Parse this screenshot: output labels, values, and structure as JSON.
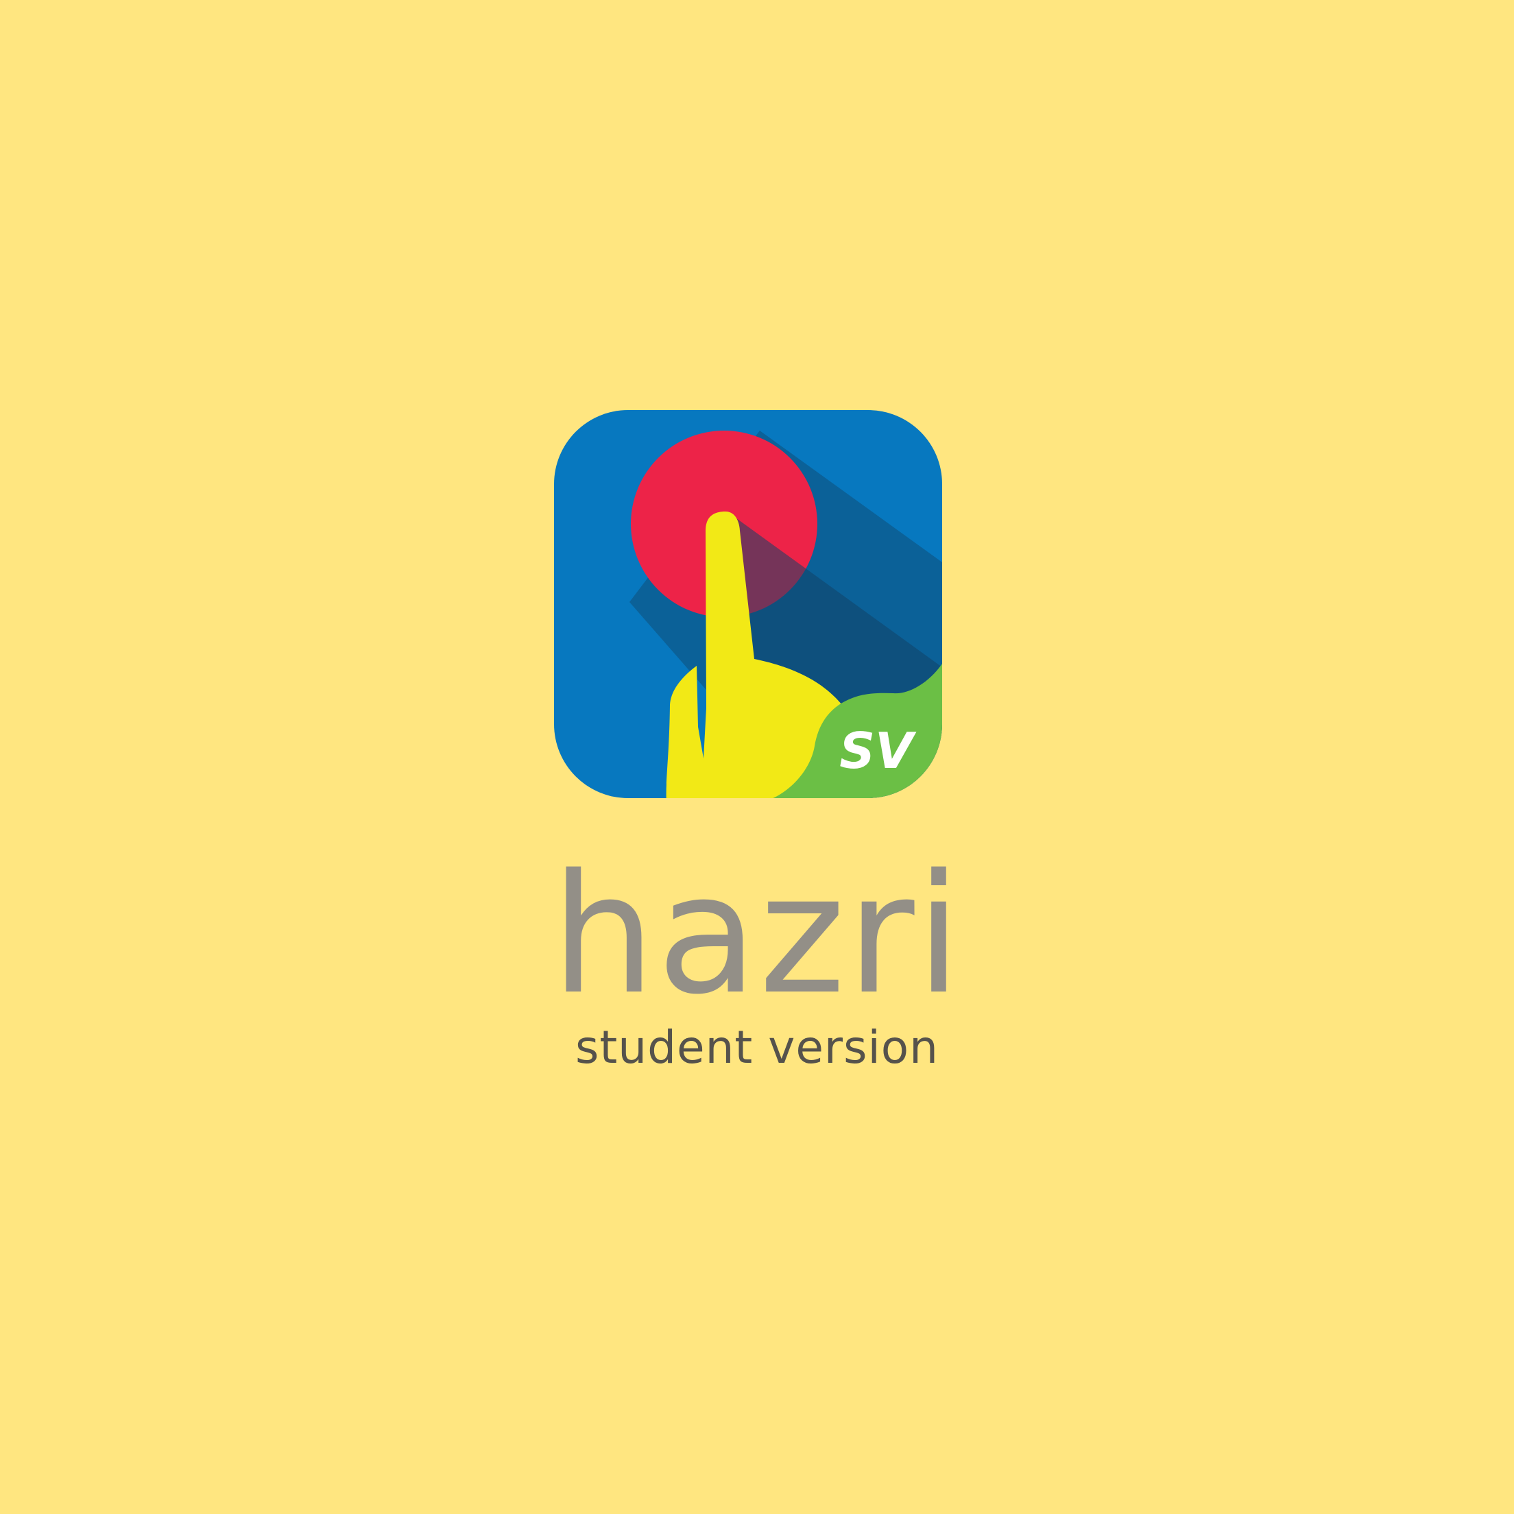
{
  "app": {
    "name": "hazri",
    "tagline": "student version",
    "badge_text": "SV"
  },
  "colors": {
    "background": "#FFE680",
    "icon_blue": "#0778BF",
    "icon_shadow": "#124468",
    "circle_red": "#ED2348",
    "finger_yellow": "#F2E916",
    "badge_green": "#6BBF45",
    "name_text": "#938F87",
    "tagline_text": "#55524C"
  },
  "icons": {
    "app_icon": "pointing-finger-tap-icon"
  }
}
